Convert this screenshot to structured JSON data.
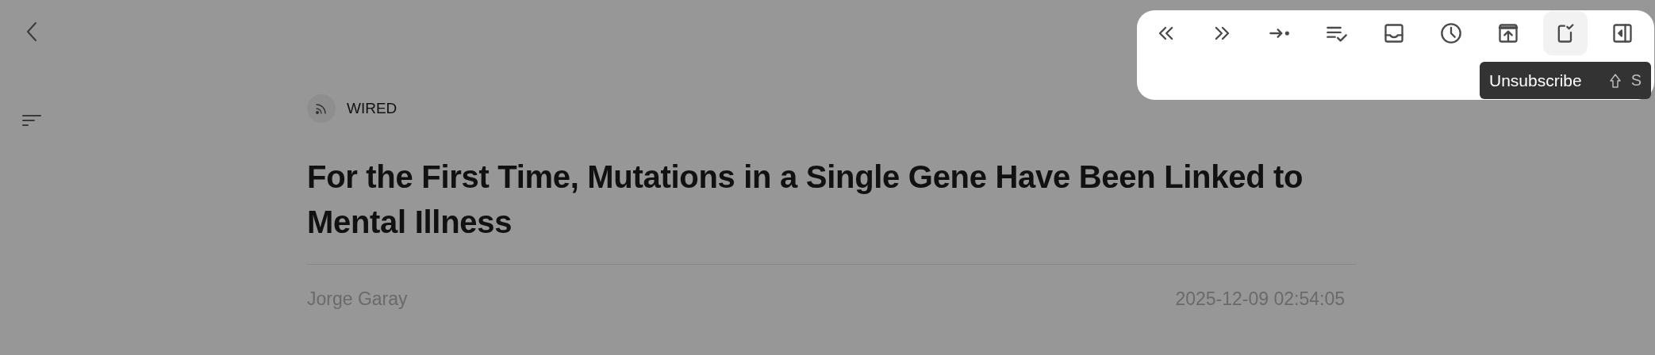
{
  "toolbar": [
    {
      "kind": "prev",
      "highlighted": false
    },
    {
      "kind": "next",
      "highlighted": false
    },
    {
      "kind": "jump",
      "highlighted": false
    },
    {
      "kind": "mark-read",
      "highlighted": false
    },
    {
      "kind": "inbox",
      "highlighted": false
    },
    {
      "kind": "clock",
      "highlighted": false
    },
    {
      "kind": "share",
      "highlighted": false
    },
    {
      "kind": "unsubscribe",
      "highlighted": true
    },
    {
      "kind": "panel",
      "highlighted": false
    }
  ],
  "tooltip": {
    "label": "Unsubscribe",
    "shortcut_key": "S"
  },
  "article": {
    "feed": "WIRED",
    "title": "For the First Time, Mutations in a Single Gene Have Been Linked to Mental Illness",
    "author": "Jorge Garay",
    "date": "2025-12-09 02:54:05"
  }
}
